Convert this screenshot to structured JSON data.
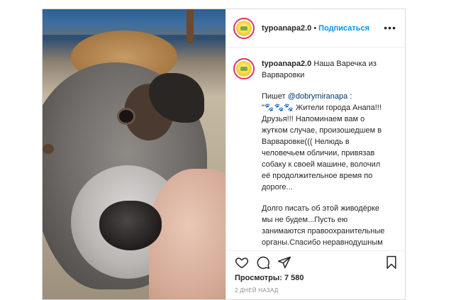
{
  "header": {
    "username": "typoanapa2.0",
    "separator": "•",
    "follow_label": "Подписаться",
    "more_label": "•••"
  },
  "caption": {
    "username": "typoanapa2.0",
    "title": "Наша Варечка из Варваровки",
    "p2_prefix": "Пишет ",
    "p2_mention": "@dobrymiranapa",
    "p2_after_mention": " :",
    "p2_text": "\"🐾🐾🐾 Жители города Анапа!!! Друзья!!! Напоминаем вам о жутком случае, произошедшем в Варваровке((( Нелюдь в человечьем обличии, привязав собаку к своей машине, волочил её продолжительное время по дороге...",
    "p3_text": "Долго писать об этой живодёрке мы не будем...Пусть ею занимаются правоохранительные органы.Спасибо неравнодушным людям!!! Парень по имени Денис спас несчастное животное и со"
  },
  "stats": {
    "views_label": "Просмотры:",
    "views_value": "7 580",
    "time_ago": "2 ДНЕЙ НАЗАД"
  },
  "icons": {
    "like": "heart-icon",
    "comment": "comment-icon",
    "share": "share-icon",
    "save": "bookmark-icon",
    "more": "more-icon"
  },
  "colors": {
    "link": "#0095f6",
    "mention": "#00376b",
    "border": "#dbdbdb",
    "muted": "#8e8e8e",
    "avatar_ring": "#e1306c"
  }
}
